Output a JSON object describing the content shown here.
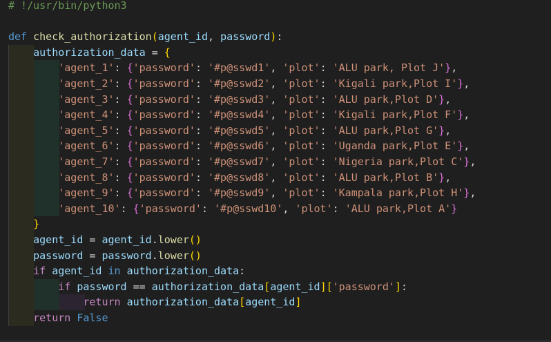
{
  "editor": {
    "language": "python",
    "lines": [
      [
        {
          "t": "# !/usr/bin/python3",
          "c": "comment"
        }
      ],
      [],
      [
        {
          "t": "def ",
          "c": "kw"
        },
        {
          "t": "check_authorization",
          "c": "fn"
        },
        {
          "t": "(",
          "c": "br1"
        },
        {
          "t": "agent_id",
          "c": "var"
        },
        {
          "t": ", ",
          "c": "pun"
        },
        {
          "t": "password",
          "c": "var"
        },
        {
          "t": ")",
          "c": "br1"
        },
        {
          "t": ":",
          "c": "pun"
        }
      ],
      [
        {
          "t": "    ",
          "c": "pun"
        },
        {
          "t": "authorization_data",
          "c": "var"
        },
        {
          "t": " = ",
          "c": "pun"
        },
        {
          "t": "{",
          "c": "br1"
        }
      ],
      [
        {
          "t": "        ",
          "c": "pun"
        },
        {
          "t": "'agent_1'",
          "c": "str"
        },
        {
          "t": ": ",
          "c": "pun"
        },
        {
          "t": "{",
          "c": "br2"
        },
        {
          "t": "'password'",
          "c": "str"
        },
        {
          "t": ": ",
          "c": "pun"
        },
        {
          "t": "'#p@sswd1'",
          "c": "str"
        },
        {
          "t": ", ",
          "c": "pun"
        },
        {
          "t": "'plot'",
          "c": "str"
        },
        {
          "t": ": ",
          "c": "pun"
        },
        {
          "t": "'ALU park, Plot J'",
          "c": "str"
        },
        {
          "t": "}",
          "c": "br2"
        },
        {
          "t": ",",
          "c": "pun"
        }
      ],
      [
        {
          "t": "        ",
          "c": "pun"
        },
        {
          "t": "'agent_2'",
          "c": "str"
        },
        {
          "t": ": ",
          "c": "pun"
        },
        {
          "t": "{",
          "c": "br2"
        },
        {
          "t": "'password'",
          "c": "str"
        },
        {
          "t": ": ",
          "c": "pun"
        },
        {
          "t": "'#p@sswd2'",
          "c": "str"
        },
        {
          "t": ", ",
          "c": "pun"
        },
        {
          "t": "'plot'",
          "c": "str"
        },
        {
          "t": ": ",
          "c": "pun"
        },
        {
          "t": "'Kigali park,Plot I'",
          "c": "str"
        },
        {
          "t": "}",
          "c": "br2"
        },
        {
          "t": ",",
          "c": "pun"
        }
      ],
      [
        {
          "t": "        ",
          "c": "pun"
        },
        {
          "t": "'agent_3'",
          "c": "str"
        },
        {
          "t": ": ",
          "c": "pun"
        },
        {
          "t": "{",
          "c": "br2"
        },
        {
          "t": "'password'",
          "c": "str"
        },
        {
          "t": ": ",
          "c": "pun"
        },
        {
          "t": "'#p@sswd3'",
          "c": "str"
        },
        {
          "t": ", ",
          "c": "pun"
        },
        {
          "t": "'plot'",
          "c": "str"
        },
        {
          "t": ": ",
          "c": "pun"
        },
        {
          "t": "'ALU park,Plot D'",
          "c": "str"
        },
        {
          "t": "}",
          "c": "br2"
        },
        {
          "t": ",",
          "c": "pun"
        }
      ],
      [
        {
          "t": "        ",
          "c": "pun"
        },
        {
          "t": "'agent_4'",
          "c": "str"
        },
        {
          "t": ": ",
          "c": "pun"
        },
        {
          "t": "{",
          "c": "br2"
        },
        {
          "t": "'password'",
          "c": "str"
        },
        {
          "t": ": ",
          "c": "pun"
        },
        {
          "t": "'#p@sswd4'",
          "c": "str"
        },
        {
          "t": ", ",
          "c": "pun"
        },
        {
          "t": "'plot'",
          "c": "str"
        },
        {
          "t": ": ",
          "c": "pun"
        },
        {
          "t": "'Kigali park,Plot F'",
          "c": "str"
        },
        {
          "t": "}",
          "c": "br2"
        },
        {
          "t": ",",
          "c": "pun"
        }
      ],
      [
        {
          "t": "        ",
          "c": "pun"
        },
        {
          "t": "'agent_5'",
          "c": "str"
        },
        {
          "t": ": ",
          "c": "pun"
        },
        {
          "t": "{",
          "c": "br2"
        },
        {
          "t": "'password'",
          "c": "str"
        },
        {
          "t": ": ",
          "c": "pun"
        },
        {
          "t": "'#p@sswd5'",
          "c": "str"
        },
        {
          "t": ", ",
          "c": "pun"
        },
        {
          "t": "'plot'",
          "c": "str"
        },
        {
          "t": ": ",
          "c": "pun"
        },
        {
          "t": "'ALU park,Plot G'",
          "c": "str"
        },
        {
          "t": "}",
          "c": "br2"
        },
        {
          "t": ",",
          "c": "pun"
        }
      ],
      [
        {
          "t": "        ",
          "c": "pun"
        },
        {
          "t": "'agent_6'",
          "c": "str"
        },
        {
          "t": ": ",
          "c": "pun"
        },
        {
          "t": "{",
          "c": "br2"
        },
        {
          "t": "'password'",
          "c": "str"
        },
        {
          "t": ": ",
          "c": "pun"
        },
        {
          "t": "'#p@sswd6'",
          "c": "str"
        },
        {
          "t": ", ",
          "c": "pun"
        },
        {
          "t": "'plot'",
          "c": "str"
        },
        {
          "t": ": ",
          "c": "pun"
        },
        {
          "t": "'Uganda park,Plot E'",
          "c": "str"
        },
        {
          "t": "}",
          "c": "br2"
        },
        {
          "t": ",",
          "c": "pun"
        }
      ],
      [
        {
          "t": "        ",
          "c": "pun"
        },
        {
          "t": "'agent_7'",
          "c": "str"
        },
        {
          "t": ": ",
          "c": "pun"
        },
        {
          "t": "{",
          "c": "br2"
        },
        {
          "t": "'password'",
          "c": "str"
        },
        {
          "t": ": ",
          "c": "pun"
        },
        {
          "t": "'#p@sswd7'",
          "c": "str"
        },
        {
          "t": ", ",
          "c": "pun"
        },
        {
          "t": "'plot'",
          "c": "str"
        },
        {
          "t": ": ",
          "c": "pun"
        },
        {
          "t": "'Nigeria park,Plot C'",
          "c": "str"
        },
        {
          "t": "}",
          "c": "br2"
        },
        {
          "t": ",",
          "c": "pun"
        }
      ],
      [
        {
          "t": "        ",
          "c": "pun"
        },
        {
          "t": "'agent_8'",
          "c": "str"
        },
        {
          "t": ": ",
          "c": "pun"
        },
        {
          "t": "{",
          "c": "br2"
        },
        {
          "t": "'password'",
          "c": "str"
        },
        {
          "t": ": ",
          "c": "pun"
        },
        {
          "t": "'#p@sswd8'",
          "c": "str"
        },
        {
          "t": ", ",
          "c": "pun"
        },
        {
          "t": "'plot'",
          "c": "str"
        },
        {
          "t": ": ",
          "c": "pun"
        },
        {
          "t": "'ALU park,Plot B'",
          "c": "str"
        },
        {
          "t": "}",
          "c": "br2"
        },
        {
          "t": ",",
          "c": "pun"
        }
      ],
      [
        {
          "t": "        ",
          "c": "pun"
        },
        {
          "t": "'agent_9'",
          "c": "str"
        },
        {
          "t": ": ",
          "c": "pun"
        },
        {
          "t": "{",
          "c": "br2"
        },
        {
          "t": "'password'",
          "c": "str"
        },
        {
          "t": ": ",
          "c": "pun"
        },
        {
          "t": "'#p@sswd9'",
          "c": "str"
        },
        {
          "t": ", ",
          "c": "pun"
        },
        {
          "t": "'plot'",
          "c": "str"
        },
        {
          "t": ": ",
          "c": "pun"
        },
        {
          "t": "'Kampala park,Plot H'",
          "c": "str"
        },
        {
          "t": "}",
          "c": "br2"
        },
        {
          "t": ",",
          "c": "pun"
        }
      ],
      [
        {
          "t": "        ",
          "c": "pun"
        },
        {
          "t": "'agent_10'",
          "c": "str"
        },
        {
          "t": ": ",
          "c": "pun"
        },
        {
          "t": "{",
          "c": "br2"
        },
        {
          "t": "'password'",
          "c": "str"
        },
        {
          "t": ": ",
          "c": "pun"
        },
        {
          "t": "'#p@sswd10'",
          "c": "str"
        },
        {
          "t": ", ",
          "c": "pun"
        },
        {
          "t": "'plot'",
          "c": "str"
        },
        {
          "t": ": ",
          "c": "pun"
        },
        {
          "t": "'ALU park,Plot A'",
          "c": "str"
        },
        {
          "t": "}",
          "c": "br2"
        }
      ],
      [
        {
          "t": "    ",
          "c": "pun"
        },
        {
          "t": "}",
          "c": "br1"
        }
      ],
      [
        {
          "t": "    ",
          "c": "pun"
        },
        {
          "t": "agent_id",
          "c": "var"
        },
        {
          "t": " = ",
          "c": "pun"
        },
        {
          "t": "agent_id",
          "c": "var"
        },
        {
          "t": ".",
          "c": "pun"
        },
        {
          "t": "lower",
          "c": "fn"
        },
        {
          "t": "()",
          "c": "br1"
        }
      ],
      [
        {
          "t": "    ",
          "c": "pun"
        },
        {
          "t": "password",
          "c": "var"
        },
        {
          "t": " = ",
          "c": "pun"
        },
        {
          "t": "password",
          "c": "var"
        },
        {
          "t": ".",
          "c": "pun"
        },
        {
          "t": "lower",
          "c": "fn"
        },
        {
          "t": "()",
          "c": "br1"
        }
      ],
      [
        {
          "t": "    ",
          "c": "pun"
        },
        {
          "t": "if",
          "c": "ctrl"
        },
        {
          "t": " ",
          "c": "pun"
        },
        {
          "t": "agent_id",
          "c": "var"
        },
        {
          "t": " ",
          "c": "pun"
        },
        {
          "t": "in",
          "c": "kw"
        },
        {
          "t": " ",
          "c": "pun"
        },
        {
          "t": "authorization_data",
          "c": "var"
        },
        {
          "t": ":",
          "c": "pun"
        }
      ],
      [
        {
          "t": "        ",
          "c": "pun"
        },
        {
          "t": "if",
          "c": "ctrl"
        },
        {
          "t": " ",
          "c": "pun"
        },
        {
          "t": "password",
          "c": "var"
        },
        {
          "t": " == ",
          "c": "pun"
        },
        {
          "t": "authorization_data",
          "c": "var"
        },
        {
          "t": "[",
          "c": "br1"
        },
        {
          "t": "agent_id",
          "c": "var"
        },
        {
          "t": "]",
          "c": "br1"
        },
        {
          "t": "[",
          "c": "br1"
        },
        {
          "t": "'password'",
          "c": "str"
        },
        {
          "t": "]",
          "c": "br1"
        },
        {
          "t": ":",
          "c": "pun"
        }
      ],
      [
        {
          "t": "            ",
          "c": "pun"
        },
        {
          "t": "return",
          "c": "ctrl"
        },
        {
          "t": " ",
          "c": "pun"
        },
        {
          "t": "authorization_data",
          "c": "var"
        },
        {
          "t": "[",
          "c": "br1"
        },
        {
          "t": "agent_id",
          "c": "var"
        },
        {
          "t": "]",
          "c": "br1"
        }
      ],
      [
        {
          "t": "    ",
          "c": "pun"
        },
        {
          "t": "return",
          "c": "ctrl"
        },
        {
          "t": " ",
          "c": "pun"
        },
        {
          "t": "False",
          "c": "kw"
        }
      ]
    ]
  }
}
